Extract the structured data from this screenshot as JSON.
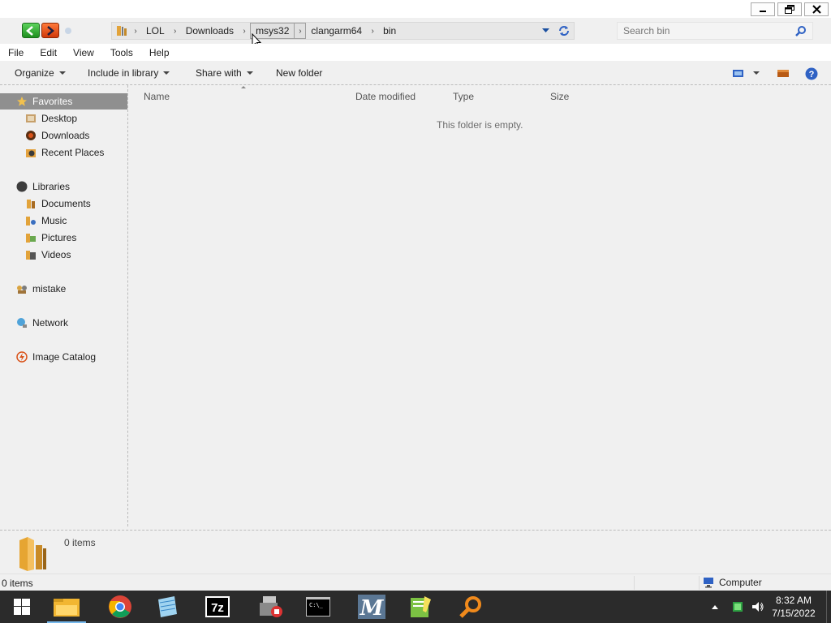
{
  "window": {
    "caption_buttons": [
      "minimize",
      "restore",
      "close"
    ]
  },
  "address": {
    "crumbs": [
      "LOL",
      "Downloads",
      "msys32",
      "clangarm64",
      "bin"
    ]
  },
  "search": {
    "placeholder": "Search bin"
  },
  "menu": {
    "items": [
      "File",
      "Edit",
      "View",
      "Tools",
      "Help"
    ]
  },
  "toolbar": {
    "organize": "Organize",
    "include_in_library": "Include in library",
    "share_with": "Share with",
    "new_folder": "New folder"
  },
  "navpane": {
    "favorites": {
      "label": "Favorites",
      "items": [
        "Desktop",
        "Downloads",
        "Recent Places"
      ]
    },
    "libraries": {
      "label": "Libraries",
      "items": [
        "Documents",
        "Music",
        "Pictures",
        "Videos"
      ]
    },
    "homegroup": "mistake",
    "network": "Network",
    "image_catalog": "Image Catalog"
  },
  "content": {
    "columns": [
      "Name",
      "Date modified",
      "Type",
      "Size"
    ],
    "empty_message": "This folder is empty."
  },
  "details": {
    "count": "0 items"
  },
  "status": {
    "count": "0 items",
    "zone": "Computer"
  },
  "taskbar": {
    "apps": [
      "start-icon",
      "file-explorer-icon",
      "chrome-icon",
      "notepad-icon",
      "7zip-icon",
      "installer-icon",
      "command-prompt-icon",
      "msys-icon",
      "notepad-plus-plus-icon",
      "search-tool-icon"
    ],
    "clock": {
      "time": "8:32 AM",
      "date": "7/15/2022"
    }
  },
  "colors": {
    "accent_taskbar": "#2b2b2b",
    "selection": "#8f8f8f",
    "taskbar_highlight": "#76b9ed"
  }
}
